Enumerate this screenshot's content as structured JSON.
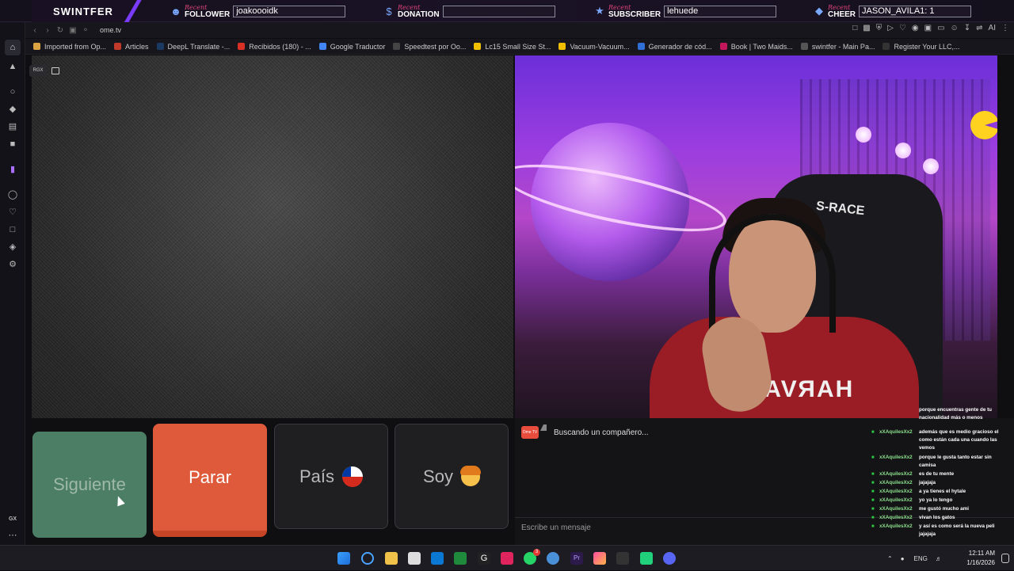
{
  "overlay": {
    "brand": "SWINTFER",
    "alerts": [
      {
        "recent": "Recent",
        "kind": "FOLLOWER",
        "value": "joakoooidk"
      },
      {
        "recent": "Recent",
        "kind": "DONATION",
        "value": ""
      },
      {
        "recent": "Recent",
        "kind": "SUBSCRIBER",
        "value": "lehuede"
      },
      {
        "recent": "Recent",
        "kind": "CHEER",
        "value": "JASON_AVILA1: 1"
      }
    ]
  },
  "browser": {
    "url": "ome.tv",
    "bookmarks": [
      {
        "label": "Imported from Op...",
        "color": "#d9a441"
      },
      {
        "label": "Articles",
        "color": "#c0392b"
      },
      {
        "label": "DeepL Translate -...",
        "color": "#1b3a63"
      },
      {
        "label": "Recibidos (180) - ...",
        "color": "#d93025"
      },
      {
        "label": "Google Traductor",
        "color": "#4285f4"
      },
      {
        "label": "Speedtest por Oo...",
        "color": "#444"
      },
      {
        "label": "Lc15 Small Size St...",
        "color": "#f0c000"
      },
      {
        "label": "Vacuum-Vacuum...",
        "color": "#f0c000"
      },
      {
        "label": "Generador de cód...",
        "color": "#2f6fd6"
      },
      {
        "label": "Book | Two Maids...",
        "color": "#c2185b"
      },
      {
        "label": "swintfer - Main Pa...",
        "color": "#555"
      },
      {
        "label": "Register Your LLC,...",
        "color": "#333"
      }
    ],
    "toolbar_ai_label": "AI",
    "sidebar_bottom_label": "GX"
  },
  "page": {
    "rgx_badge": "RGX",
    "buttons": {
      "next": "Siguiente",
      "stop": "Parar",
      "country": "País",
      "me": "Soy"
    },
    "chat": {
      "searching": "Buscando un compañero...",
      "placeholder": "Escribe un mensaje",
      "logo_text": "Ome TV"
    },
    "webcam": {
      "chair_brand": "S-RACE",
      "hoodie_text": "HARVARD"
    }
  },
  "stream_chat": [
    {
      "user": "",
      "text": "porque encuentras gente de tu"
    },
    {
      "user": "",
      "text": "nacionalidad más o menos"
    },
    {
      "user": "xXAquilesXx2",
      "text": "además que es medio gracioso el"
    },
    {
      "user": "",
      "text": "como están cada una cuando las"
    },
    {
      "user": "",
      "text": "vemos"
    },
    {
      "user": "xXAquilesXx2",
      "text": "porque le gusta tanto estar sin"
    },
    {
      "user": "",
      "text": "camisa"
    },
    {
      "user": "xXAquilesXx2",
      "text": "es de tu mente"
    },
    {
      "user": "xXAquilesXx2",
      "text": "jajajaja"
    },
    {
      "user": "xXAquilesXx2",
      "text": "a ya tienes el hytale"
    },
    {
      "user": "xXAquilesXx2",
      "text": "yo ya lo tengo"
    },
    {
      "user": "xXAquilesXx2",
      "text": "me gustó mucho ami"
    },
    {
      "user": "xXAquilesXx2",
      "text": "vivan los gatos"
    },
    {
      "user": "xXAquilesXx2",
      "text": "y así es como será la nueva peli"
    },
    {
      "user": "",
      "text": "jajajaja"
    }
  ],
  "taskbar": {
    "language": "ENG",
    "time": "12:11 AM",
    "date": "1/16/2026",
    "whatsapp_badge": "3"
  }
}
